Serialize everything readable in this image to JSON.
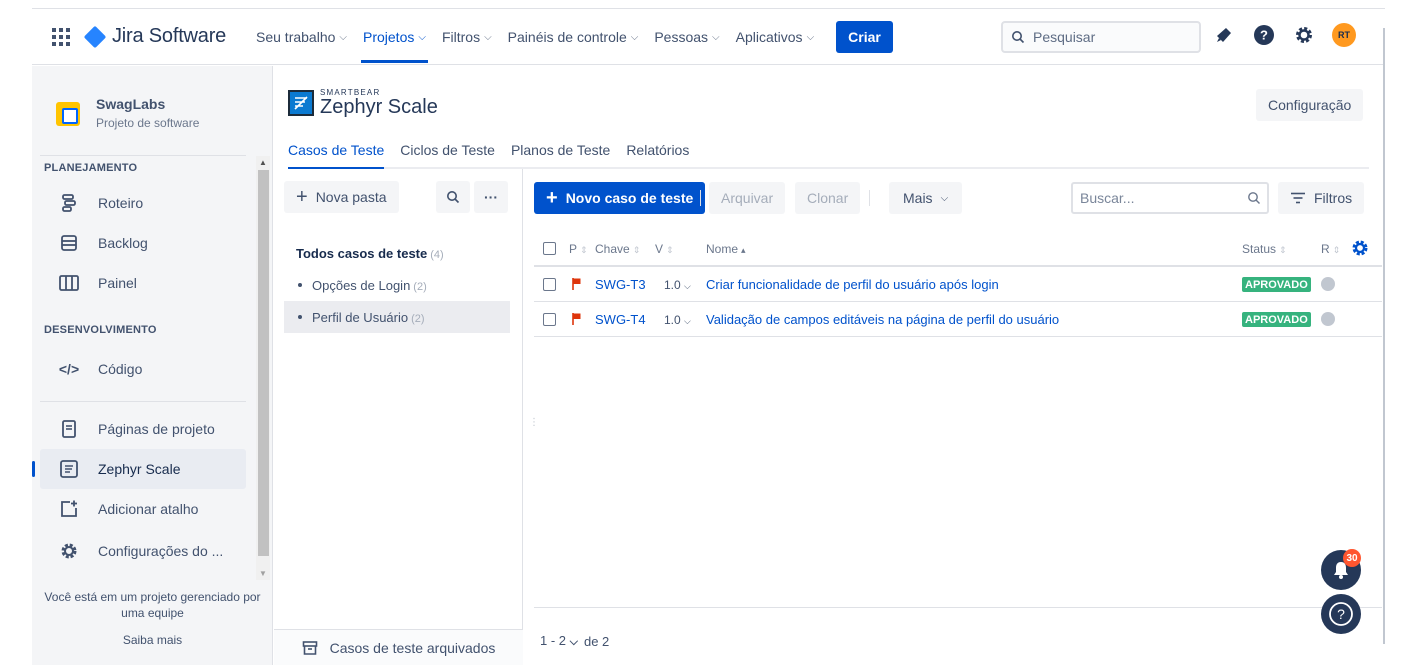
{
  "topnav": {
    "app_name": "Jira Software",
    "items": [
      {
        "label": "Seu trabalho",
        "active": false
      },
      {
        "label": "Projetos",
        "active": true
      },
      {
        "label": "Filtros",
        "active": false
      },
      {
        "label": "Painéis de controle",
        "active": false
      },
      {
        "label": "Pessoas",
        "active": false
      },
      {
        "label": "Aplicativos",
        "active": false
      }
    ],
    "create_label": "Criar",
    "search_placeholder": "Pesquisar",
    "avatar_initials": "RT"
  },
  "sidebar": {
    "project_name": "SwagLabs",
    "project_type": "Projeto de software",
    "section_planning": "PLANEJAMENTO",
    "planning_items": [
      {
        "label": "Roteiro",
        "icon": "roadmap-icon"
      },
      {
        "label": "Backlog",
        "icon": "backlog-icon"
      },
      {
        "label": "Painel",
        "icon": "board-icon"
      }
    ],
    "section_dev": "DESENVOLVIMENTO",
    "dev_items": [
      {
        "label": "Código",
        "icon": "code-icon"
      }
    ],
    "other_items": [
      {
        "label": "Páginas de projeto",
        "icon": "pages-icon"
      },
      {
        "label": "Zephyr Scale",
        "icon": "zephyr-icon",
        "selected": true
      },
      {
        "label": "Adicionar atalho",
        "icon": "add-shortcut-icon"
      },
      {
        "label": "Configurações do ...",
        "icon": "gear-icon"
      }
    ],
    "footer_text": "Você está em um projeto gerenciado por uma equipe",
    "footer_link": "Saiba mais"
  },
  "zephyr": {
    "brand_small": "SMARTBEAR",
    "brand_big": "Zephyr Scale",
    "config_label": "Configuração",
    "tabs": [
      {
        "label": "Casos de Teste",
        "active": true
      },
      {
        "label": "Ciclos de Teste",
        "active": false
      },
      {
        "label": "Planos de Teste",
        "active": false
      },
      {
        "label": "Relatórios",
        "active": false
      }
    ]
  },
  "folders": {
    "new_folder_label": "Nova pasta",
    "all_label": "Todos casos de teste",
    "all_count": "(4)",
    "items": [
      {
        "label": "Opções de Login",
        "count": "(2)",
        "selected": false
      },
      {
        "label": "Perfil de Usuário",
        "count": "(2)",
        "selected": true
      }
    ],
    "archived_label": "Casos de teste arquivados"
  },
  "toolbar": {
    "new_case_label": "Novo caso de teste",
    "archive_label": "Arquivar",
    "clone_label": "Clonar",
    "more_label": "Mais",
    "search_placeholder": "Buscar...",
    "filters_label": "Filtros"
  },
  "table": {
    "headers": {
      "p": "P",
      "key": "Chave",
      "v": "V",
      "name": "Nome",
      "status": "Status",
      "r": "R"
    },
    "rows": [
      {
        "key": "SWG-T3",
        "version": "1.0",
        "name": "Criar funcionalidade de perfil do usuário após login",
        "status": "APROVADO"
      },
      {
        "key": "SWG-T4",
        "version": "1.0",
        "name": "Validação de campos editáveis na página de perfil do usuário",
        "status": "APROVADO"
      }
    ]
  },
  "pager": {
    "range": "1 - 2",
    "of_text": "de 2"
  },
  "notifications": {
    "count": "30"
  },
  "colors": {
    "accent": "#0052cc",
    "status_green": "#36b37e",
    "flag_red": "#de350b",
    "badge": "#ff5630"
  }
}
